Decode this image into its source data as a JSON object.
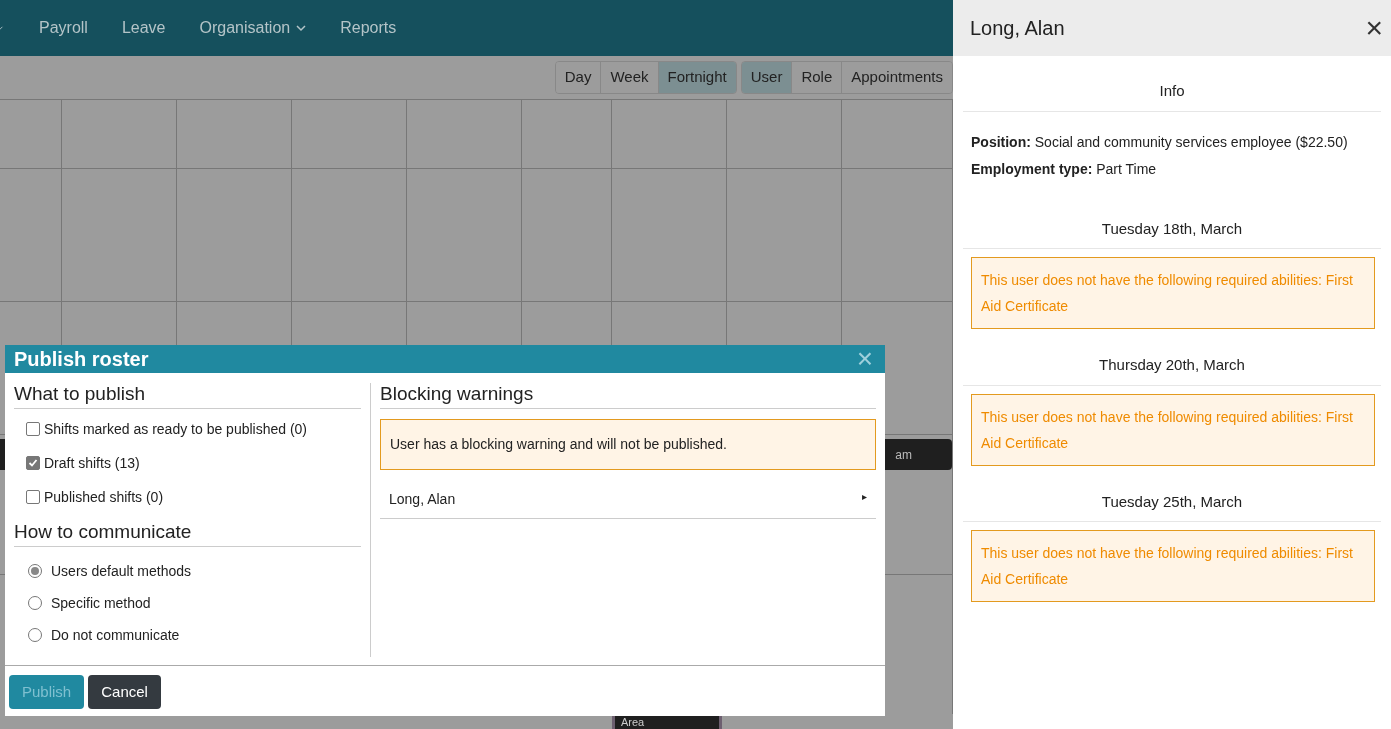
{
  "navbar": {
    "items": [
      {
        "label": "Payroll",
        "has_menu": false
      },
      {
        "label": "Leave",
        "has_menu": false
      },
      {
        "label": "Organisation",
        "has_menu": true
      },
      {
        "label": "Reports",
        "has_menu": false
      }
    ]
  },
  "view_buttons": [
    {
      "label": "Day",
      "selected": false
    },
    {
      "label": "Week",
      "selected": false
    },
    {
      "label": "Fortnight",
      "selected": true
    }
  ],
  "group_buttons": [
    {
      "label": "User",
      "selected": true
    },
    {
      "label": "Role",
      "selected": false
    },
    {
      "label": "Appointments",
      "selected": false
    }
  ],
  "background_shifts": [
    {
      "text": "am"
    },
    {
      "text": "Area"
    }
  ],
  "modal": {
    "title": "Publish roster",
    "close": "×",
    "what_to_publish": {
      "heading": "What to publish",
      "options": [
        {
          "label": "Shifts marked as ready to be published (0)",
          "checked": false
        },
        {
          "label": "Draft shifts (13)",
          "checked": true
        },
        {
          "label": "Published shifts (0)",
          "checked": false
        }
      ]
    },
    "how_to_communicate": {
      "heading": "How to communicate",
      "options": [
        {
          "label": "Users default methods",
          "selected": true
        },
        {
          "label": "Specific method",
          "selected": false
        },
        {
          "label": "Do not communicate",
          "selected": false
        }
      ]
    },
    "blocking": {
      "heading": "Blocking warnings",
      "alert": "User has a blocking warning and will not be published.",
      "users": [
        {
          "name": "Long, Alan",
          "caret": "▸"
        }
      ]
    },
    "buttons": [
      {
        "label": "Publish",
        "kind": "primary",
        "disabled": true
      },
      {
        "label": "Cancel",
        "kind": "dark",
        "disabled": false
      }
    ]
  },
  "side_panel": {
    "title": "Long, Alan",
    "close": "×",
    "info_heading": "Info",
    "fields": [
      {
        "label": "Position:",
        "value": "Social and community services employee ($22.50)"
      },
      {
        "label": "Employment type:",
        "value": "Part Time"
      }
    ],
    "days": [
      {
        "date": "Tuesday 18th, March",
        "warning": "This user does not have the following required abilities: First Aid Certificate"
      },
      {
        "date": "Thursday 20th, March",
        "warning": "This user does not have the following required abilities: First Aid Certificate"
      },
      {
        "date": "Tuesday 25th, March",
        "warning": "This user does not have the following required abilities: First Aid Certificate"
      }
    ]
  }
}
